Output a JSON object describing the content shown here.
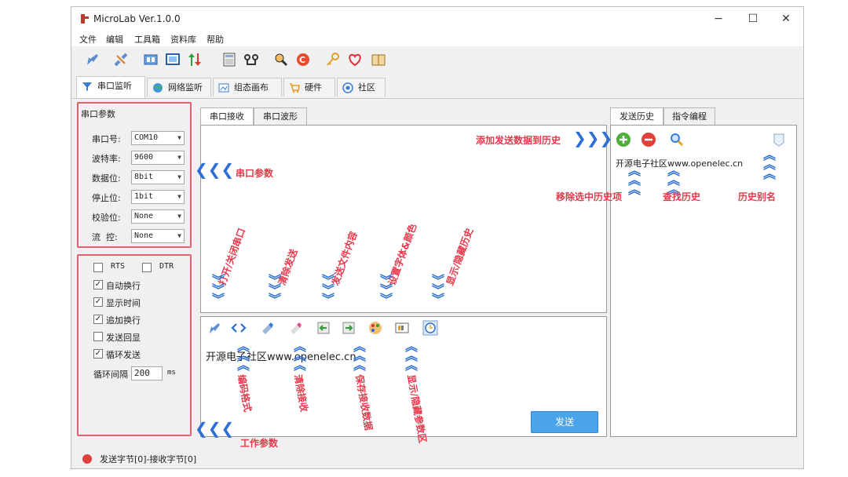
{
  "window": {
    "title": "MicroLab Ver.1.0.0",
    "min": "−",
    "max": "☐",
    "close": "✕"
  },
  "menu": [
    "文件",
    "编辑",
    "工具箱",
    "资料库",
    "帮助"
  ],
  "main_tabs": [
    "串口监听",
    "网络监听",
    "组态画布",
    "硬件",
    "社区"
  ],
  "serial_params": {
    "title": "串口参数",
    "fields": [
      {
        "label": "串口号:",
        "value": "COM10"
      },
      {
        "label": "波特率:",
        "value": "9600"
      },
      {
        "label": "数据位:",
        "value": "8bit"
      },
      {
        "label": "停止位:",
        "value": "1bit"
      },
      {
        "label": "校验位:",
        "value": "None"
      },
      {
        "label": "流  控:",
        "value": "None"
      }
    ]
  },
  "work_params": {
    "rts": "RTS",
    "dtr": "DTR",
    "options": [
      {
        "label": "自动换行",
        "checked": true
      },
      {
        "label": "显示时间",
        "checked": true
      },
      {
        "label": "追加换行",
        "checked": true
      },
      {
        "label": "发送回显",
        "checked": false
      },
      {
        "label": "循环发送",
        "checked": true
      }
    ],
    "interval_label": "循环间隔",
    "interval_value": "200",
    "interval_unit": "ms"
  },
  "receive_tabs": [
    "串口接收",
    "串口波形"
  ],
  "send_text": "开源电子社区www.openelec.cn",
  "send_button": "发送",
  "history_tabs": [
    "发送历史",
    "指令编程"
  ],
  "history_item": "开源电子社区www.openelec.cn",
  "status": "发送字节[0]-接收字节[0]",
  "annotations": {
    "serial": "串口参数",
    "work": "工作参数",
    "add_history": "添加发送数据到历史",
    "remove_history": "移除选中历史项",
    "find_history": "查找历史",
    "alias_history": "历史别名",
    "open_close": "打开/关闭串口",
    "clear_send": "清除发送",
    "send_file": "发送文件内容",
    "font_color": "设置字体&颜色",
    "toggle_history": "显示/隐藏历史",
    "encoding": "编码格式",
    "clear_receive": "清除接收",
    "save_receive": "保存接收数据",
    "toggle_params": "显示/隐藏参数区"
  }
}
